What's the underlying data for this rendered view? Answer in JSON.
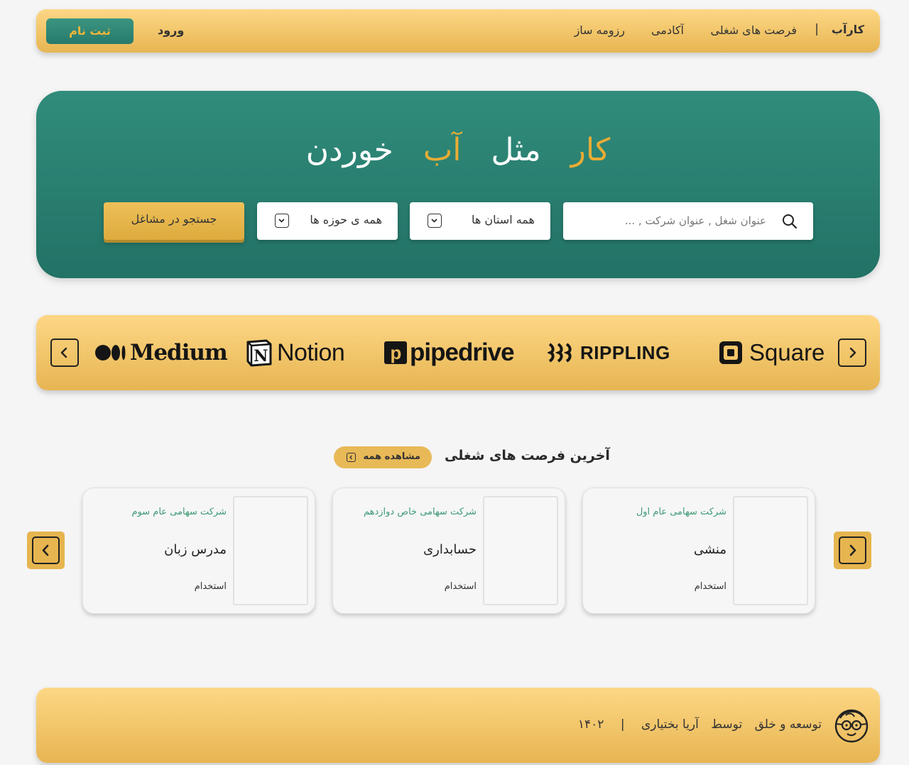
{
  "nav": {
    "brand": "کارآب",
    "separator": "|",
    "links": [
      "فرصت های شغلی",
      "آکادمی",
      "رزومه ساز"
    ],
    "login": "ورود",
    "signup": "ثبت نام"
  },
  "hero": {
    "title_words": [
      "کار",
      "مثل",
      "آب",
      "خوردن"
    ],
    "search_placeholder": "عنوان شغل , عنوان شرکت , ...",
    "province_select": "همه استان ها",
    "field_select": "همه ی حوزه ها",
    "search_button": "جستجو در مشاغل"
  },
  "brands": [
    "Medium",
    "Notion",
    "pipedrive",
    "RIPPLING",
    "Square"
  ],
  "jobs": {
    "title": "آخرین فرصت های شغلی",
    "view_all": "مشاهده همه",
    "cards": [
      {
        "company": "شرکت سهامی عام اول",
        "title": "منشی",
        "type": "استخدام"
      },
      {
        "company": "شرکت سهامی خاص دوازدهم",
        "title": "حسابداری",
        "type": "استخدام"
      },
      {
        "company": "شرکت سهامی عام سوم",
        "title": "مدرس زبان",
        "type": "استخدام"
      }
    ]
  },
  "footer": {
    "develop": "توسعه و خلق",
    "by": "توسط",
    "author": "آریا بختیاری",
    "separator": "|",
    "year": "۱۴۰۲"
  },
  "colors": {
    "gold": "#e8ac35",
    "teal": "#2a7f70",
    "company_green": "#3e9a76"
  }
}
